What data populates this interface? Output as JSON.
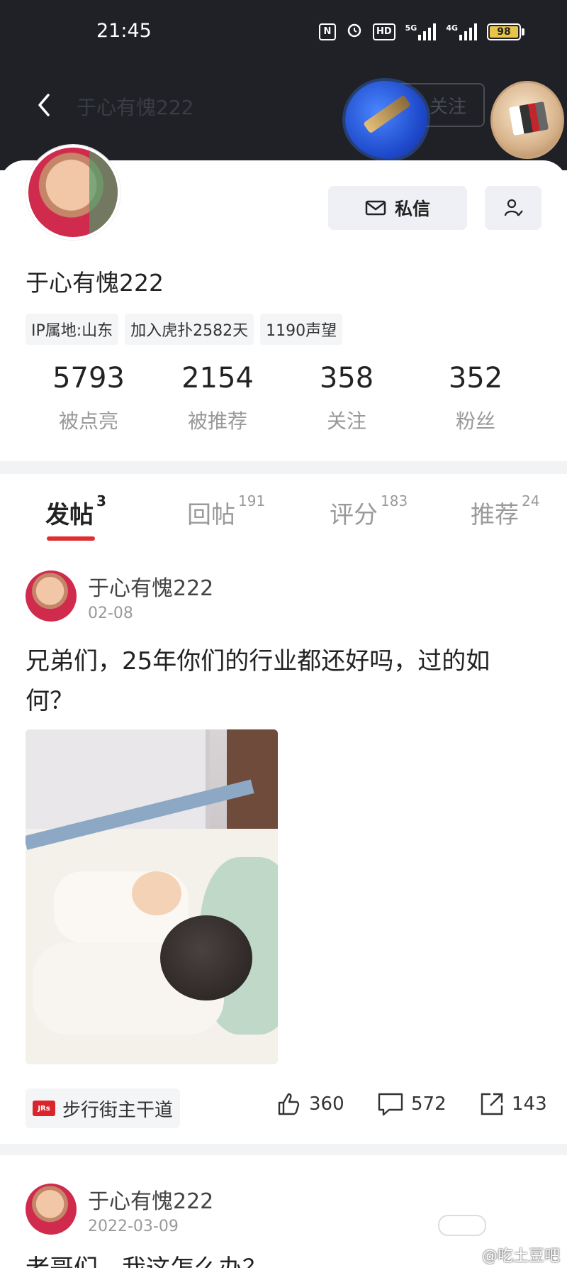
{
  "status_bar": {
    "time": "21:45",
    "icons": [
      "nfc-icon",
      "alarm-icon",
      "hd-icon",
      "5g-signal-icon",
      "4g-signal-icon"
    ],
    "hd_label": "HD",
    "net1": "5G",
    "net2": "4G",
    "battery": "98"
  },
  "nav": {
    "back_icon": "chevron-left-icon",
    "title": "于心有愧222",
    "follow_label": "关注"
  },
  "profile": {
    "name": "于心有愧222",
    "message_button": "私信",
    "tags": [
      "IP属地:山东",
      "加入虎扑2582天",
      "1190声望"
    ],
    "stats": [
      {
        "value": "5793",
        "label": "被点亮"
      },
      {
        "value": "2154",
        "label": "被推荐"
      },
      {
        "value": "358",
        "label": "关注"
      },
      {
        "value": "352",
        "label": "粉丝"
      }
    ]
  },
  "tabs": [
    {
      "label": "发帖",
      "count": "3",
      "active": true
    },
    {
      "label": "回帖",
      "count": "191",
      "active": false
    },
    {
      "label": "评分",
      "count": "183",
      "active": false
    },
    {
      "label": "推荐",
      "count": "24",
      "active": false
    }
  ],
  "posts": [
    {
      "author": "于心有愧222",
      "date": "02-08",
      "text": "兄弟们，25年你们的行业都还好吗，过的如何？",
      "topic": "步行街主干道",
      "likes": "360",
      "comments": "572",
      "shares": "143"
    },
    {
      "author": "于心有愧222",
      "date": "2022-03-09",
      "text_partial": "老哥们，我这怎么办？"
    }
  ],
  "watermark": "@吃土豆吧",
  "colors": {
    "accent_red": "#e02e2e",
    "header_dark": "#1f2127",
    "button_bg": "#eef0f6"
  }
}
